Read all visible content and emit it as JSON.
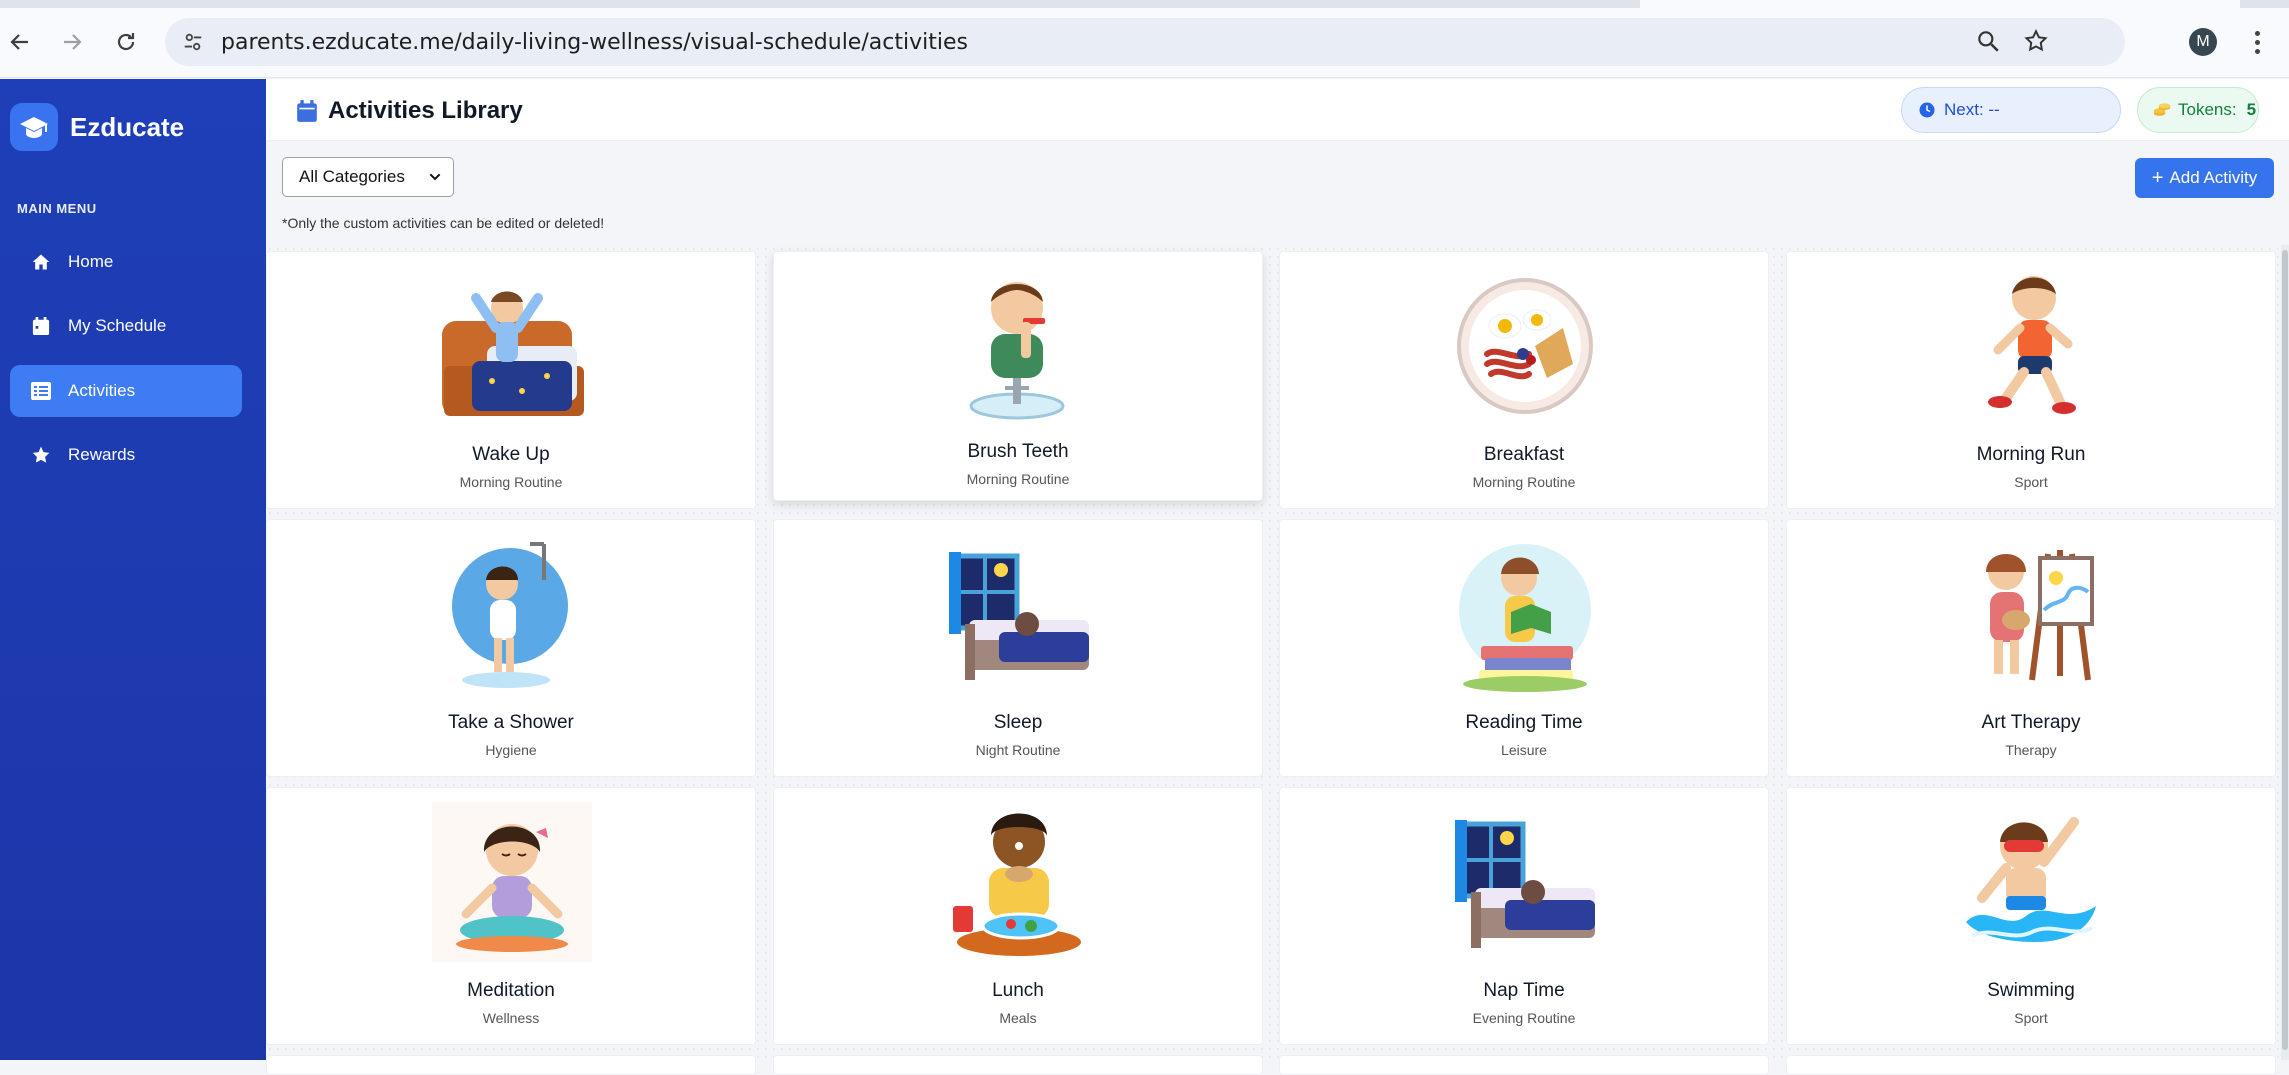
{
  "browser": {
    "url": "parents.ezducate.me/daily-living-wellness/visual-schedule/activities",
    "profile_initial": "M"
  },
  "sidebar": {
    "brand": "Ezducate",
    "menu_title": "MAIN MENU",
    "items": [
      {
        "label": "Home",
        "icon": "home-icon",
        "active": false
      },
      {
        "label": "My Schedule",
        "icon": "calendar-icon",
        "active": false
      },
      {
        "label": "Activities",
        "icon": "list-icon",
        "active": true
      },
      {
        "label": "Rewards",
        "icon": "star-icon",
        "active": false
      }
    ]
  },
  "header": {
    "title": "Activities Library",
    "next_label": "Next: --",
    "tokens_label": "Tokens:",
    "tokens_value": "5"
  },
  "toolbar": {
    "filter_value": "All Categories",
    "add_label": "Add Activity",
    "note": "*Only the custom activities can be edited or deleted!"
  },
  "activities": [
    {
      "name": "Wake Up",
      "category": "Morning Routine",
      "icon": "bed-icon"
    },
    {
      "name": "Brush Teeth",
      "category": "Morning Routine",
      "icon": "toothbrush-icon"
    },
    {
      "name": "Breakfast",
      "category": "Morning Routine",
      "icon": "plate-icon"
    },
    {
      "name": "Morning Run",
      "category": "Sport",
      "icon": "runner-icon"
    },
    {
      "name": "Take a Shower",
      "category": "Hygiene",
      "icon": "shower-icon"
    },
    {
      "name": "Sleep",
      "category": "Night Routine",
      "icon": "moon-icon"
    },
    {
      "name": "Reading Time",
      "category": "Leisure",
      "icon": "book-icon"
    },
    {
      "name": "Art Therapy",
      "category": "Therapy",
      "icon": "easel-icon"
    },
    {
      "name": "Meditation",
      "category": "Wellness",
      "icon": "lotus-icon"
    },
    {
      "name": "Lunch",
      "category": "Meals",
      "icon": "lunch-icon"
    },
    {
      "name": "Nap Time",
      "category": "Evening Routine",
      "icon": "moon-icon"
    },
    {
      "name": "Swimming",
      "category": "Sport",
      "icon": "swim-icon"
    }
  ],
  "colors": {
    "sidebar": "#1e3fb8",
    "accent": "#3674ee",
    "active_nav": "#3d7cf2"
  }
}
